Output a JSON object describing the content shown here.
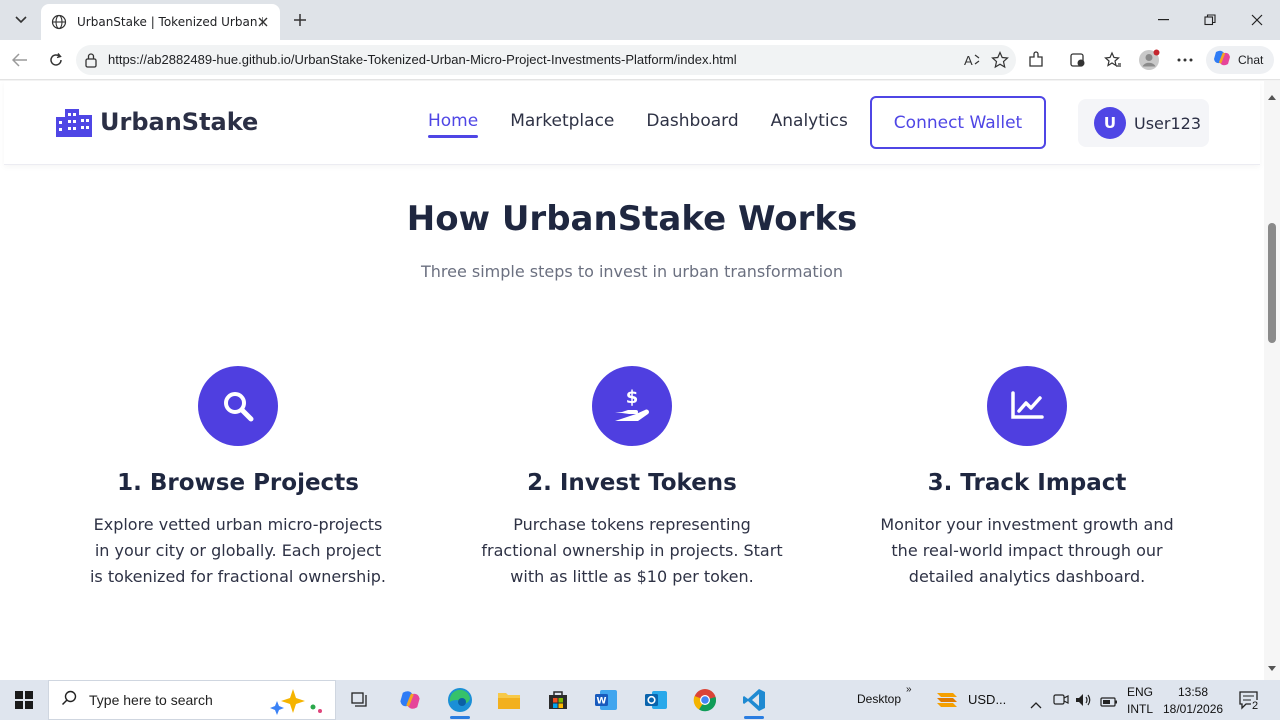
{
  "browser": {
    "tab_title": "UrbanStake | Tokenized Urban Mic",
    "url": "https://ab2882489-hue.github.io/UrbanStake-Tokenized-Urban-Micro-Project-Investments-Platform/index.html",
    "chat_label": "Chat"
  },
  "site": {
    "brand": "UrbanStake",
    "nav": [
      "Home",
      "Marketplace",
      "Dashboard",
      "Analytics"
    ],
    "active_nav": "Home",
    "connect_wallet": "Connect Wallet",
    "user": {
      "initial": "U",
      "name": "User123"
    },
    "accent_color": "#4f46e5"
  },
  "section": {
    "title": "How UrbanStake Works",
    "subtitle": "Three simple steps to invest in urban transformation",
    "steps": [
      {
        "icon": "search-icon",
        "title": "1. Browse Projects",
        "desc": "Explore vetted urban micro-projects in your city or globally. Each project is tokenized for fractional ownership."
      },
      {
        "icon": "hand-dollar-icon",
        "title": "2. Invest Tokens",
        "desc": "Purchase tokens representing fractional ownership in projects. Start with as little as $10 per token."
      },
      {
        "icon": "chart-line-icon",
        "title": "3. Track Impact",
        "desc": "Monitor your investment growth and the real-world impact through our detailed analytics dashboard."
      }
    ]
  },
  "taskbar": {
    "search_placeholder": "Type here to search",
    "desktop_label": "Desktop",
    "currency_label": "USD...",
    "lang_top": "ENG",
    "lang_bottom": "INTL",
    "time": "13:58",
    "date": "18/01/2026",
    "notification_count": "2"
  }
}
